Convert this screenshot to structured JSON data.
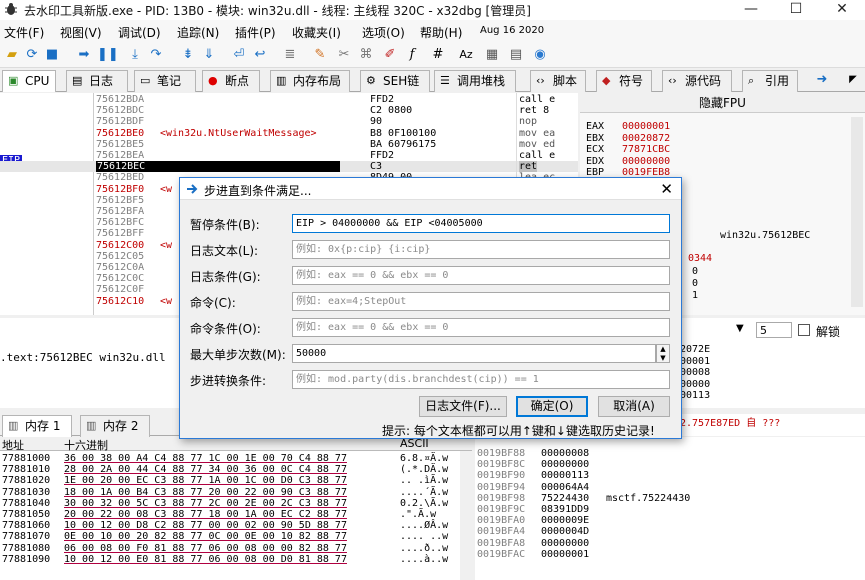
{
  "window": {
    "title": "去水印工具新版.exe - PID: 13B0 - 模块: win32u.dll - 线程: 主线程 320C - x32dbg [管理员]",
    "minimize": "—",
    "maximize": "☐",
    "close": "✕"
  },
  "menu": [
    "文件(F)",
    "视图(V)",
    "调试(D)",
    "追踪(N)",
    "插件(P)",
    "收藏夹(I)",
    "选项(O)",
    "帮助(H)",
    "Aug 16 2020"
  ],
  "toolbar_icons": [
    "open-icon",
    "restart-icon",
    "close-debug-icon",
    "run-icon",
    "pause-icon",
    "step-into-icon",
    "step-over-icon",
    "trace-into-icon",
    "trace-over-icon",
    "run-to-user-icon",
    "run-to-return-icon",
    "script-icon",
    "patch-icon",
    "comment-icon",
    "label-icon",
    "bookmark-icon",
    "function-icon",
    "hash-icon",
    "font-icon",
    "calculator-icon",
    "globe-icon"
  ],
  "tabs": [
    {
      "label": "CPU",
      "icon": "cpu-icon"
    },
    {
      "label": "日志",
      "icon": "log-icon"
    },
    {
      "label": "笔记",
      "icon": "notes-icon"
    },
    {
      "label": "断点",
      "icon": "breakpoint-icon"
    },
    {
      "label": "内存布局",
      "icon": "memory-map-icon"
    },
    {
      "label": "SEH链",
      "icon": "seh-icon"
    },
    {
      "label": "调用堆栈",
      "icon": "call-stack-icon"
    },
    {
      "label": "脚本",
      "icon": "script-icon"
    },
    {
      "label": "符号",
      "icon": "symbols-icon"
    },
    {
      "label": "源代码",
      "icon": "source-icon"
    },
    {
      "label": "引用",
      "icon": "references-icon"
    }
  ],
  "disasm": [
    {
      "addr": "75612BDA",
      "bytes": "FFD2",
      "asm": "call e",
      "note": ""
    },
    {
      "addr": "75612BDC",
      "bytes": "C2 0800",
      "asm": "ret 8",
      "note": ""
    },
    {
      "addr": "75612BDF",
      "bytes": "90",
      "asm": "nop",
      "note": ""
    },
    {
      "addr": "75612BE0",
      "bytes": "B8 0F100100",
      "asm": "mov ea",
      "note": "<win32u.NtUserWaitMessage>"
    },
    {
      "addr": "75612BE5",
      "bytes": "BA 60796175",
      "asm": "mov ed",
      "note": ""
    },
    {
      "addr": "75612BEA",
      "bytes": "FFD2",
      "asm": "call e",
      "note": ""
    },
    {
      "addr": "75612BEC",
      "bytes": "C3",
      "asm": "ret",
      "note": ""
    },
    {
      "addr": "75612BED",
      "bytes": "8D49 00",
      "asm": "lea ec",
      "note": ""
    },
    {
      "addr": "75612BF0",
      "bytes": "",
      "asm": "",
      "note": "<w"
    },
    {
      "addr": "75612BF5",
      "bytes": "",
      "asm": "",
      "note": ""
    },
    {
      "addr": "75612BFA",
      "bytes": "",
      "asm": "",
      "note": ""
    },
    {
      "addr": "75612BFC",
      "bytes": "",
      "asm": "",
      "note": ""
    },
    {
      "addr": "75612BFF",
      "bytes": "",
      "asm": "",
      "note": ""
    },
    {
      "addr": "75612C00",
      "bytes": "",
      "asm": "",
      "note": "<w"
    },
    {
      "addr": "75612C05",
      "bytes": "",
      "asm": "",
      "note": ""
    },
    {
      "addr": "75612C0A",
      "bytes": "",
      "asm": "",
      "note": ""
    },
    {
      "addr": "75612C0C",
      "bytes": "",
      "asm": "",
      "note": ""
    },
    {
      "addr": "75612C0F",
      "bytes": "",
      "asm": "",
      "note": ""
    },
    {
      "addr": "75612C10",
      "bytes": "",
      "asm": "",
      "note": "<w"
    }
  ],
  "eip_label": "EIP",
  "fpu_header": "隐藏FPU",
  "registers": [
    {
      "name": "EAX",
      "value": "00000001"
    },
    {
      "name": "EBX",
      "value": "00020872"
    },
    {
      "name": "ECX",
      "value": "77871CBC"
    },
    {
      "name": "EDX",
      "value": "00000000"
    },
    {
      "name": "EBP",
      "value": "0019FEB8"
    }
  ],
  "reg_annotation": "win32u.75612BEC",
  "reg_partial": [
    "0344",
    "0",
    "0",
    "1"
  ],
  "info_line": ".text:75612BEC win32u.dll",
  "args_count": "5",
  "unlock_label": "解锁",
  "stack_top_values": [
    "2072E",
    "00001",
    "00008",
    "00000",
    "00113"
  ],
  "stack_return_text": "2.757E87ED 自 ???",
  "bottom_tabs": [
    "内存 1",
    "内存 2"
  ],
  "dump_headers": {
    "address": "地址",
    "hex": "十六进制",
    "ascii": "ASCII"
  },
  "dump": [
    {
      "addr": "77881000",
      "hex": "36 00 38 00  A4 C4 88 77  1C 00 1E 00  70 C4 88 77",
      "ascii": "6.8.¤Ä.w"
    },
    {
      "addr": "77881010",
      "hex": "28 00 2A 00  44 C4 88 77  34 00 36 00  0C C4 88 77",
      "ascii": "(.*.DÄ.w"
    },
    {
      "addr": "77881020",
      "hex": "1E 00 20 00  EC C3 88 77  1A 00 1C 00  D0 C3 88 77",
      "ascii": ".. .ìÃ.w"
    },
    {
      "addr": "77881030",
      "hex": "18 00 1A 00  B4 C3 88 77  20 00 22 00  90 C3 88 77",
      "ascii": "....´Ã.w"
    },
    {
      "addr": "77881040",
      "hex": "30 00 32 00  5C C3 88 77  2C 00 2E 00  2C C3 88 77",
      "ascii": "0.2.\\Ã.w"
    },
    {
      "addr": "77881050",
      "hex": "20 00 22 00  08 C3 88 77  18 00 1A 00  EC C2 88 77",
      "ascii": " .\".Ã.w"
    },
    {
      "addr": "77881060",
      "hex": "10 00 12 00  D8 C2 88 77  00 00 02 00  90 5D 88 77",
      "ascii": "....ØÂ.w"
    },
    {
      "addr": "77881070",
      "hex": "0E 00 10 00  20 82 88 77  0C 00 0E 00  10 82 88 77",
      "ascii": ".... ..w"
    },
    {
      "addr": "77881080",
      "hex": "06 00 08 00  F0 81 88 77  06 00 08 00  00 82 88 77",
      "ascii": "....ð..w"
    },
    {
      "addr": "77881090",
      "hex": "10 00 12 00  E0 81 88 77  06 00 08 00  D0 81 88 77",
      "ascii": "....à..w"
    }
  ],
  "stack": [
    {
      "addr": "0019BF88",
      "val": "00000008",
      "note": ""
    },
    {
      "addr": "0019BF8C",
      "val": "00000000",
      "note": ""
    },
    {
      "addr": "0019BF90",
      "val": "00000113",
      "note": ""
    },
    {
      "addr": "0019BF94",
      "val": "000064A4",
      "note": ""
    },
    {
      "addr": "0019BF98",
      "val": "75224430",
      "note": "msctf.75224430"
    },
    {
      "addr": "0019BF9C",
      "val": "08391DD9",
      "note": ""
    },
    {
      "addr": "0019BFA0",
      "val": "0000009E",
      "note": ""
    },
    {
      "addr": "0019BFA4",
      "val": "0000004D",
      "note": ""
    },
    {
      "addr": "0019BFA8",
      "val": "00000000",
      "note": ""
    },
    {
      "addr": "0019BFAC",
      "val": "00000001",
      "note": ""
    }
  ],
  "dialog": {
    "title": "步进直到条件满足...",
    "fields": [
      {
        "label": "暂停条件(B):",
        "value": "EIP > 04000000 && EIP <04005000",
        "placeholder": ""
      },
      {
        "label": "日志文本(L):",
        "value": "",
        "placeholder": "例如: 0x{p:cip} {i:cip}"
      },
      {
        "label": "日志条件(G):",
        "value": "",
        "placeholder": "例如: eax == 0 && ebx == 0"
      },
      {
        "label": "命令(C):",
        "value": "",
        "placeholder": "例如: eax=4;StepOut"
      },
      {
        "label": "命令条件(O):",
        "value": "",
        "placeholder": "例如: eax == 0 && ebx == 0"
      },
      {
        "label": "最大单步次数(M):",
        "value": "50000",
        "placeholder": ""
      },
      {
        "label": "步进转换条件:",
        "value": "",
        "placeholder": "例如: mod.party(dis.branchdest(cip)) == 1"
      }
    ],
    "logfile_button": "日志文件(F)...",
    "ok_button": "确定(O)",
    "cancel_button": "取消(A)",
    "hint": "提示: 每个文本框都可以用↑键和↓键选取历史记录!"
  }
}
